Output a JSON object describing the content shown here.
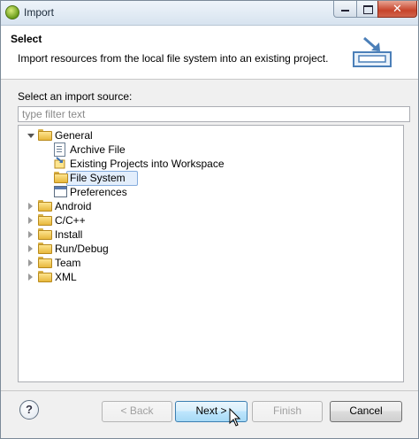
{
  "window": {
    "title": "Import"
  },
  "banner": {
    "title": "Select",
    "description": "Import resources from the local file system into an existing project."
  },
  "source": {
    "label": "Select an import source:",
    "filter_placeholder": "type filter text"
  },
  "tree": {
    "general": {
      "label": "General",
      "children": [
        {
          "label": "Archive File",
          "icon": "archive-file-icon"
        },
        {
          "label": "Existing Projects into Workspace",
          "icon": "project-icon"
        },
        {
          "label": "File System",
          "icon": "folder-icon",
          "selected": true
        },
        {
          "label": "Preferences",
          "icon": "preferences-icon"
        }
      ]
    },
    "categories": [
      {
        "label": "Android"
      },
      {
        "label": "C/C++"
      },
      {
        "label": "Install"
      },
      {
        "label": "Run/Debug"
      },
      {
        "label": "Team"
      },
      {
        "label": "XML"
      }
    ]
  },
  "buttons": {
    "back": "< Back",
    "next": "Next >",
    "finish": "Finish",
    "cancel": "Cancel",
    "help": "?"
  }
}
